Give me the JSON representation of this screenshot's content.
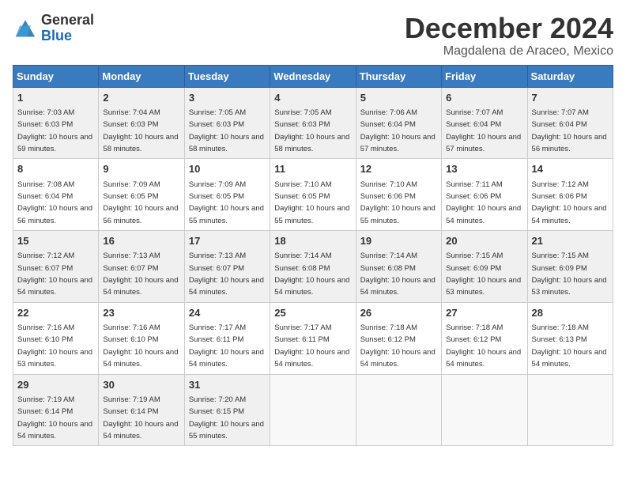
{
  "header": {
    "logo_general": "General",
    "logo_blue": "Blue",
    "month": "December 2024",
    "location": "Magdalena de Araceo, Mexico"
  },
  "days_of_week": [
    "Sunday",
    "Monday",
    "Tuesday",
    "Wednesday",
    "Thursday",
    "Friday",
    "Saturday"
  ],
  "weeks": [
    [
      {
        "day": "1",
        "sunrise": "7:03 AM",
        "sunset": "6:03 PM",
        "daylight": "10 hours and 59 minutes."
      },
      {
        "day": "2",
        "sunrise": "7:04 AM",
        "sunset": "6:03 PM",
        "daylight": "10 hours and 58 minutes."
      },
      {
        "day": "3",
        "sunrise": "7:05 AM",
        "sunset": "6:03 PM",
        "daylight": "10 hours and 58 minutes."
      },
      {
        "day": "4",
        "sunrise": "7:05 AM",
        "sunset": "6:03 PM",
        "daylight": "10 hours and 58 minutes."
      },
      {
        "day": "5",
        "sunrise": "7:06 AM",
        "sunset": "6:04 PM",
        "daylight": "10 hours and 57 minutes."
      },
      {
        "day": "6",
        "sunrise": "7:07 AM",
        "sunset": "6:04 PM",
        "daylight": "10 hours and 57 minutes."
      },
      {
        "day": "7",
        "sunrise": "7:07 AM",
        "sunset": "6:04 PM",
        "daylight": "10 hours and 56 minutes."
      }
    ],
    [
      {
        "day": "8",
        "sunrise": "7:08 AM",
        "sunset": "6:04 PM",
        "daylight": "10 hours and 56 minutes."
      },
      {
        "day": "9",
        "sunrise": "7:09 AM",
        "sunset": "6:05 PM",
        "daylight": "10 hours and 56 minutes."
      },
      {
        "day": "10",
        "sunrise": "7:09 AM",
        "sunset": "6:05 PM",
        "daylight": "10 hours and 55 minutes."
      },
      {
        "day": "11",
        "sunrise": "7:10 AM",
        "sunset": "6:05 PM",
        "daylight": "10 hours and 55 minutes."
      },
      {
        "day": "12",
        "sunrise": "7:10 AM",
        "sunset": "6:06 PM",
        "daylight": "10 hours and 55 minutes."
      },
      {
        "day": "13",
        "sunrise": "7:11 AM",
        "sunset": "6:06 PM",
        "daylight": "10 hours and 54 minutes."
      },
      {
        "day": "14",
        "sunrise": "7:12 AM",
        "sunset": "6:06 PM",
        "daylight": "10 hours and 54 minutes."
      }
    ],
    [
      {
        "day": "15",
        "sunrise": "7:12 AM",
        "sunset": "6:07 PM",
        "daylight": "10 hours and 54 minutes."
      },
      {
        "day": "16",
        "sunrise": "7:13 AM",
        "sunset": "6:07 PM",
        "daylight": "10 hours and 54 minutes."
      },
      {
        "day": "17",
        "sunrise": "7:13 AM",
        "sunset": "6:07 PM",
        "daylight": "10 hours and 54 minutes."
      },
      {
        "day": "18",
        "sunrise": "7:14 AM",
        "sunset": "6:08 PM",
        "daylight": "10 hours and 54 minutes."
      },
      {
        "day": "19",
        "sunrise": "7:14 AM",
        "sunset": "6:08 PM",
        "daylight": "10 hours and 54 minutes."
      },
      {
        "day": "20",
        "sunrise": "7:15 AM",
        "sunset": "6:09 PM",
        "daylight": "10 hours and 53 minutes."
      },
      {
        "day": "21",
        "sunrise": "7:15 AM",
        "sunset": "6:09 PM",
        "daylight": "10 hours and 53 minutes."
      }
    ],
    [
      {
        "day": "22",
        "sunrise": "7:16 AM",
        "sunset": "6:10 PM",
        "daylight": "10 hours and 53 minutes."
      },
      {
        "day": "23",
        "sunrise": "7:16 AM",
        "sunset": "6:10 PM",
        "daylight": "10 hours and 54 minutes."
      },
      {
        "day": "24",
        "sunrise": "7:17 AM",
        "sunset": "6:11 PM",
        "daylight": "10 hours and 54 minutes."
      },
      {
        "day": "25",
        "sunrise": "7:17 AM",
        "sunset": "6:11 PM",
        "daylight": "10 hours and 54 minutes."
      },
      {
        "day": "26",
        "sunrise": "7:18 AM",
        "sunset": "6:12 PM",
        "daylight": "10 hours and 54 minutes."
      },
      {
        "day": "27",
        "sunrise": "7:18 AM",
        "sunset": "6:12 PM",
        "daylight": "10 hours and 54 minutes."
      },
      {
        "day": "28",
        "sunrise": "7:18 AM",
        "sunset": "6:13 PM",
        "daylight": "10 hours and 54 minutes."
      }
    ],
    [
      {
        "day": "29",
        "sunrise": "7:19 AM",
        "sunset": "6:14 PM",
        "daylight": "10 hours and 54 minutes."
      },
      {
        "day": "30",
        "sunrise": "7:19 AM",
        "sunset": "6:14 PM",
        "daylight": "10 hours and 54 minutes."
      },
      {
        "day": "31",
        "sunrise": "7:20 AM",
        "sunset": "6:15 PM",
        "daylight": "10 hours and 55 minutes."
      },
      null,
      null,
      null,
      null
    ]
  ]
}
